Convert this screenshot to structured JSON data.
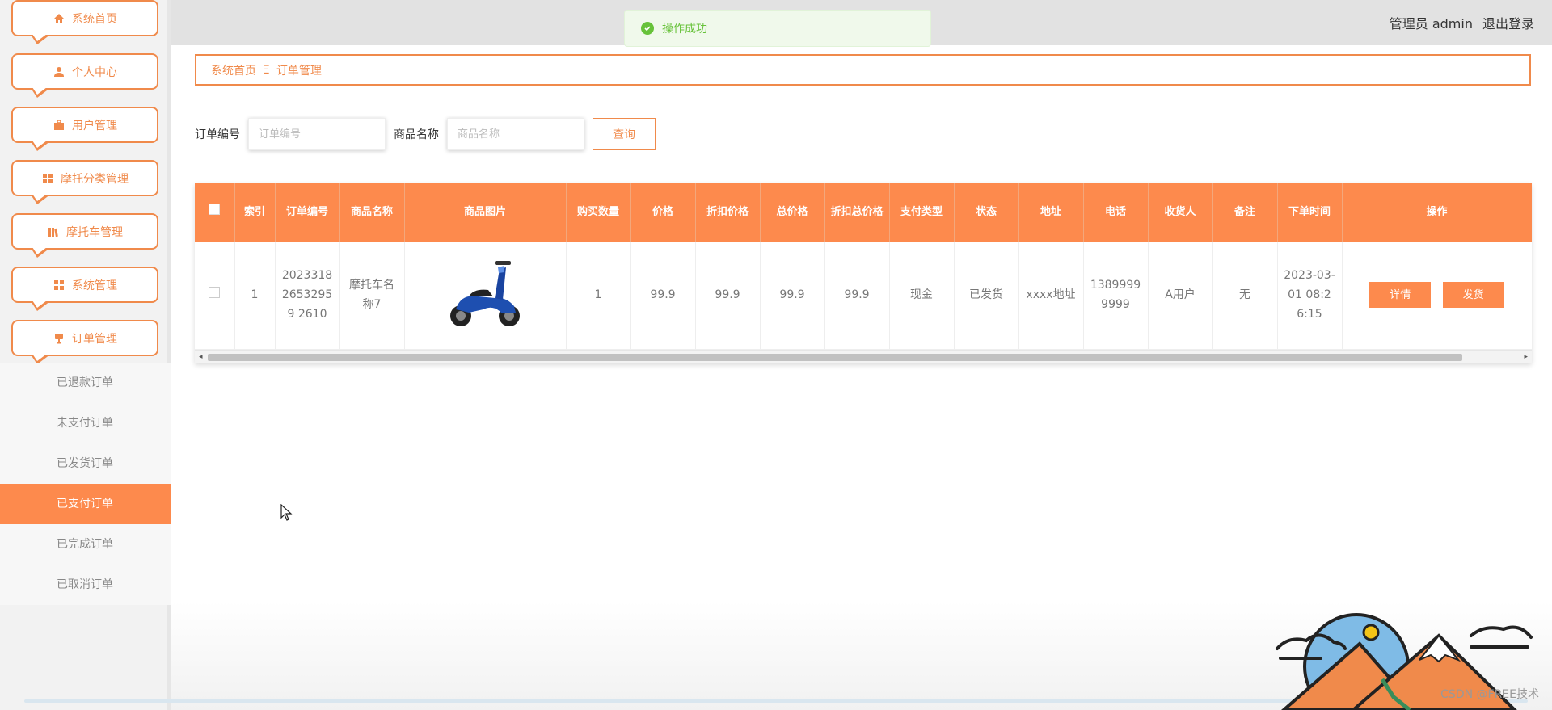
{
  "sidebar": {
    "menu": [
      {
        "label": "系统首页",
        "icon": "home-icon"
      },
      {
        "label": "个人中心",
        "icon": "user-icon"
      },
      {
        "label": "用户管理",
        "icon": "briefcase-icon"
      },
      {
        "label": "摩托分类管理",
        "icon": "grid-icon"
      },
      {
        "label": "摩托车管理",
        "icon": "books-icon"
      },
      {
        "label": "系统管理",
        "icon": "grid-icon"
      },
      {
        "label": "订单管理",
        "icon": "cup-icon"
      }
    ],
    "submenu": [
      {
        "label": "已退款订单",
        "active": false
      },
      {
        "label": "未支付订单",
        "active": false
      },
      {
        "label": "已发货订单",
        "active": false
      },
      {
        "label": "已支付订单",
        "active": true
      },
      {
        "label": "已完成订单",
        "active": false
      },
      {
        "label": "已取消订单",
        "active": false
      }
    ]
  },
  "topbar": {
    "user_label": "管理员 admin",
    "logout_label": "退出登录"
  },
  "toast": {
    "message": "操作成功",
    "icon": "check-circle-icon"
  },
  "breadcrumb": {
    "home": "系统首页",
    "separator": "Ξ",
    "current": "订单管理"
  },
  "search": {
    "order_label": "订单编号",
    "order_placeholder": "订单编号",
    "order_value": "",
    "product_label": "商品名称",
    "product_placeholder": "商品名称",
    "product_value": "",
    "button_label": "查询"
  },
  "table": {
    "headers": [
      "索引",
      "订单编号",
      "商品名称",
      "商品图片",
      "购买数量",
      "价格",
      "折扣价格",
      "总价格",
      "折扣总价格",
      "支付类型",
      "状态",
      "地址",
      "电话",
      "收货人",
      "备注",
      "下单时间",
      "操作"
    ],
    "rows": [
      {
        "index": "1",
        "order_no": "202331826532959 2610",
        "product_name": "摩托车名称7",
        "image": "blue-scooter-image",
        "quantity": "1",
        "price": "99.9",
        "discount_price": "99.9",
        "total_price": "99.9",
        "discount_total": "99.9",
        "pay_type": "现金",
        "status": "已发货",
        "address": "xxxx地址",
        "phone": "13899999999",
        "receiver": "A用户",
        "remark": "无",
        "order_time": "2023-03-01 08:26:15",
        "detail_btn": "详情",
        "ship_btn": "发货"
      }
    ]
  },
  "watermark": "CSDN @FREE技术",
  "colors": {
    "accent": "#fd8a4d",
    "border_accent": "#f08a4b",
    "toast_green": "#67c23a"
  }
}
